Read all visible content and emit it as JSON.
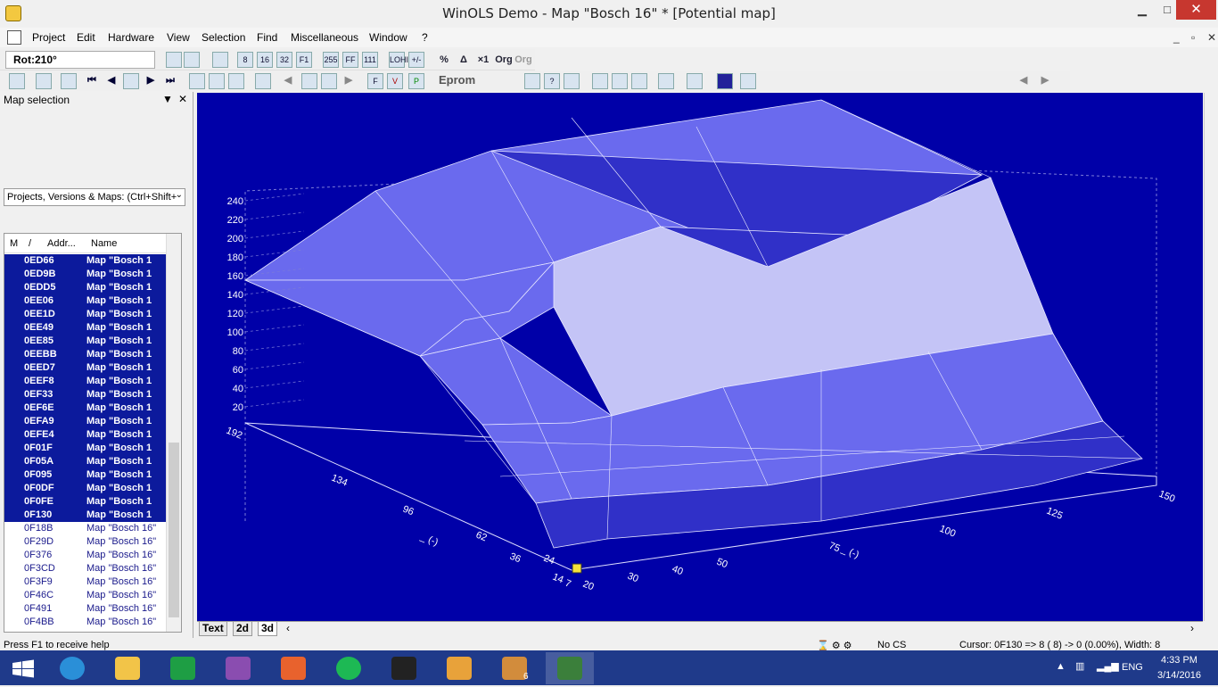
{
  "window": {
    "title": "WinOLS Demo - Map \"Bosch 16\" *   [Potential map]",
    "minimize": "▁",
    "maximize": "□",
    "close": "✕"
  },
  "menu": [
    "Project",
    "Edit",
    "Hardware",
    "View",
    "Selection",
    "Find",
    "Miscellaneous",
    "Window",
    "?"
  ],
  "mdi_controls": {
    "minimize": "_",
    "restore": "▫",
    "close": "✕"
  },
  "toolbar1": {
    "rotation": "Rot:210°",
    "buttons": [
      "8",
      "16",
      "32",
      "F1",
      "255",
      "FF",
      "111",
      "LOHI",
      "+/-",
      "%",
      "Δ",
      "×1",
      "Org",
      "Org"
    ]
  },
  "toolbar2": {
    "eprom_label": "Eprom"
  },
  "map_selection": {
    "title": "Map selection",
    "dropdown_icon": "▼",
    "close_icon": "✕",
    "combo": "Projects, Versions & Maps:  (Ctrl+Shift+",
    "columns": {
      "m": "M",
      "sort": "/",
      "addr": "Addr...",
      "name": "Name"
    },
    "rows": [
      {
        "addr": "0ED66",
        "name": "Map \"Bosch 1",
        "sel": true
      },
      {
        "addr": "0ED9B",
        "name": "Map \"Bosch 1",
        "sel": true
      },
      {
        "addr": "0EDD5",
        "name": "Map \"Bosch 1",
        "sel": true
      },
      {
        "addr": "0EE06",
        "name": "Map \"Bosch 1",
        "sel": true
      },
      {
        "addr": "0EE1D",
        "name": "Map \"Bosch 1",
        "sel": true
      },
      {
        "addr": "0EE49",
        "name": "Map \"Bosch 1",
        "sel": true
      },
      {
        "addr": "0EE85",
        "name": "Map \"Bosch 1",
        "sel": true
      },
      {
        "addr": "0EEBB",
        "name": "Map \"Bosch 1",
        "sel": true
      },
      {
        "addr": "0EED7",
        "name": "Map \"Bosch 1",
        "sel": true
      },
      {
        "addr": "0EEF8",
        "name": "Map \"Bosch 1",
        "sel": true
      },
      {
        "addr": "0EF33",
        "name": "Map \"Bosch 1",
        "sel": true
      },
      {
        "addr": "0EF6E",
        "name": "Map \"Bosch 1",
        "sel": true
      },
      {
        "addr": "0EFA9",
        "name": "Map \"Bosch 1",
        "sel": true
      },
      {
        "addr": "0EFE4",
        "name": "Map \"Bosch 1",
        "sel": true
      },
      {
        "addr": "0F01F",
        "name": "Map \"Bosch 1",
        "sel": true
      },
      {
        "addr": "0F05A",
        "name": "Map \"Bosch 1",
        "sel": true
      },
      {
        "addr": "0F095",
        "name": "Map \"Bosch 1",
        "sel": true
      },
      {
        "addr": "0F0DF",
        "name": "Map \"Bosch 1",
        "sel": true
      },
      {
        "addr": "0F0FE",
        "name": "Map \"Bosch 1",
        "sel": true
      },
      {
        "addr": "0F130",
        "name": "Map \"Bosch 1",
        "sel": true
      },
      {
        "addr": "0F18B",
        "name": "Map \"Bosch 16\"",
        "sel": false
      },
      {
        "addr": "0F29D",
        "name": "Map \"Bosch 16\"",
        "sel": false
      },
      {
        "addr": "0F376",
        "name": "Map \"Bosch 16\"",
        "sel": false
      },
      {
        "addr": "0F3CD",
        "name": "Map \"Bosch 16\"",
        "sel": false
      },
      {
        "addr": "0F3F9",
        "name": "Map \"Bosch 16\"",
        "sel": false
      },
      {
        "addr": "0F46C",
        "name": "Map \"Bosch 16\"",
        "sel": false
      },
      {
        "addr": "0F491",
        "name": "Map \"Bosch 16\"",
        "sel": false
      },
      {
        "addr": "0F4BB",
        "name": "Map \"Bosch 16\"",
        "sel": false
      }
    ]
  },
  "chart_data": {
    "type": "surface3d",
    "z_ticks": [
      20,
      40,
      60,
      80,
      100,
      120,
      140,
      160,
      180,
      200,
      220,
      240
    ],
    "x_axis_label": "_ (-)",
    "x_ticks": [
      "20",
      "30",
      "40",
      "50",
      "75",
      "100",
      "125",
      "150"
    ],
    "y_axis_label": "_ (-)",
    "y_ticks": [
      "7",
      "14",
      "24",
      "36",
      "62",
      "96",
      "134",
      "192"
    ],
    "colors": {
      "background": "#0000a8",
      "surface_light": "#c4c4f6",
      "surface_mid": "#6a6aee",
      "surface_dark": "#3030c8"
    }
  },
  "view_tabs": [
    "Text",
    "2d",
    "3d"
  ],
  "status": {
    "help": "Press F1 to receive help",
    "cs": "No CS",
    "cursor": "Cursor: 0F130 =>   8 ( 8) ->   0 (0.00%), Width: 8"
  },
  "taskbar": {
    "lang": "ENG",
    "time": "4:33 PM",
    "date": "3/14/2016",
    "badge": "6"
  }
}
